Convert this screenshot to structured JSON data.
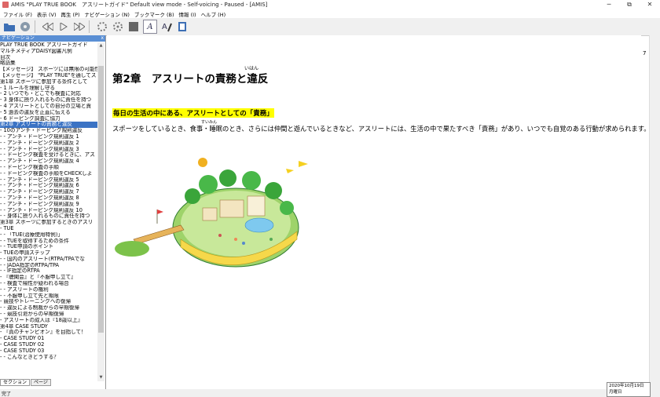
{
  "window": {
    "title": "AMIS \"PLAY TRUE BOOK　アスリートガイド\" Default view mode - Self-voicing - Paused - [AMIS]",
    "minimize": "─",
    "maximize": "⧉",
    "close": "✕"
  },
  "menu": [
    "ファイル (F)",
    "表示 (V)",
    "再生 (P)",
    "ナビゲーション (N)",
    "ブックマーク (B)",
    "情報 (I)",
    "ヘルプ (H)"
  ],
  "toolbar_icons": [
    "open-icon",
    "disc-icon",
    "rewind-icon",
    "play-icon",
    "fast-forward-icon",
    "settings-icon",
    "settings-alt-icon",
    "stop-icon",
    "text-style-icon",
    "font-color-icon",
    "bookmark-icon"
  ],
  "nav": {
    "header": "ナビゲーション",
    "close": "x",
    "items": [
      "PLAY TRUE BOOK アスリートガイド",
      "マルチメディアDAISY図書凡例",
      "目次",
      "略語集",
      "【メッセージ】 スポーツには無限の可能性",
      "【メッセージ】 \"PLAY TRUE\"を通してス",
      "第1章 スポーツに参加する条件として",
      "- 1 ルールを理解し守る",
      "- 2 いつでも・どこでも検査に対応",
      "- 3 身体に摂り入れるものに責任を持つ",
      "- 4 アスリートとしての自分の立場と責",
      "- 5 過去の違反を正直に伝える",
      "- 6 ドーピング調査に協力",
      "第2章 アスリートの責務と違反",
      "- 10のアンチ・ドーピング規則違反",
      "- - アンチ・ドーピング規則違反 1",
      "- - アンチ・ドーピング規則違反 2",
      "- - アンチ・ドーピング規則違反 3",
      "- - ドーピング検査を受けるときに、アス",
      "- - アンチ・ドーピング規則違反 4",
      "- - ドーピング検査の手順",
      "- - ドーピング検査の手順をCHECKしよ",
      "- - アンチ・ドーピング規則違反 5",
      "- - アンチ・ドーピング規則違反 6",
      "- - アンチ・ドーピング規則違反 7",
      "- - アンチ・ドーピング規則違反 8",
      "- - アンチ・ドーピング規則違反 9",
      "- - アンチ・ドーピング規則違反 10",
      "- - 身体に摂り入れるものに責任を持つ",
      "第3章 スポーツに参加するときのアスリ",
      "- TUE",
      "- - 「TUE(治療使用特例)」",
      "- - TUEを取得するための条件",
      "- - TUE申請のポイント",
      "- TUEの申請ステップ",
      "- - 国内のアスリート(RTPA/TPAでな",
      "- - JADA指定のRTPA/TPA",
      "- - IF指定のRTPA",
      "- 『聴聞会』と『不服申し立て』",
      "- - 検査で陽性が疑われる場合",
      "- - アスリートの権利",
      "- - 不服申し立て先と期限",
      "- 競技やトレーニングへの復帰",
      "- - 違反による制裁からの早期復帰",
      "- - 競技引退からの早期復帰",
      "- アスリートの成人は『18歳以上』",
      "第4章 CASE STUDY",
      "- 『真のチャンピオン』を目指して！",
      "- CASE STUDY 01",
      "- CASE STUDY 02",
      "- CASE STUDY 03",
      "- - こんなときどうする？"
    ],
    "selected_index": 13,
    "tabs": [
      "セクション",
      "ページ"
    ]
  },
  "content": {
    "page_number": "7",
    "chapter_title": "第2章　アスリートの責務と違反",
    "chapter_ruby": "いはん",
    "highlight": "毎日の生活の中にある、アスリートとしての「責務」",
    "paragraph": "スポーツをしているとき、食事・睡眠のとき、さらには仲間と遊んでいるときなど、アスリートには、生活の中で果たすべき「責務」があり、いつでも自覚のある行動が求められます。",
    "paragraph_ruby": "すいみん"
  },
  "status": {
    "text": "完了",
    "date": "2020年10月19日",
    "day": "月曜日"
  }
}
